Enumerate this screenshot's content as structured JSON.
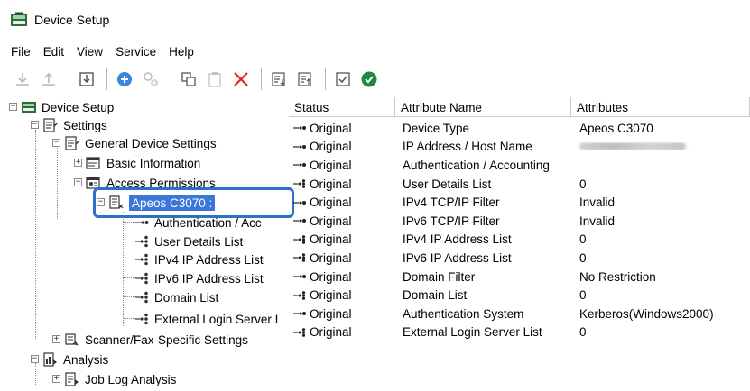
{
  "window": {
    "title": "Device Setup"
  },
  "menu": [
    "File",
    "Edit",
    "View",
    "Service",
    "Help"
  ],
  "tree": {
    "root": "Device Setup",
    "settings": "Settings",
    "general": "General Device Settings",
    "basic": "Basic Information",
    "access": "Access Permissions",
    "device": "Apeos C3070 :",
    "children": [
      "Authentication / Acc",
      "User Details List",
      "IPv4 IP Address List",
      "IPv6 IP Address List",
      "Domain List",
      "External Login Server I"
    ],
    "scanner": "Scanner/Fax-Specific Settings",
    "analysis": "Analysis",
    "joblog": "Job Log Analysis"
  },
  "table": {
    "headers": [
      "Status",
      "Attribute Name",
      "Attributes"
    ],
    "rows": [
      {
        "status": "Original",
        "icon": "single-link-icon",
        "name": "Device Type",
        "value": "Apeos C3070"
      },
      {
        "status": "Original",
        "icon": "single-link-icon",
        "name": "IP Address / Host Name",
        "value": "",
        "blurred": true
      },
      {
        "status": "Original",
        "icon": "single-link-icon",
        "name": "Authentication / Accounting",
        "value": ""
      },
      {
        "status": "Original",
        "icon": "multi-link-icon",
        "name": "User Details List",
        "value": "0"
      },
      {
        "status": "Original",
        "icon": "single-link-icon",
        "name": "IPv4 TCP/IP Filter",
        "value": "Invalid"
      },
      {
        "status": "Original",
        "icon": "single-link-icon",
        "name": "IPv6 TCP/IP Filter",
        "value": "Invalid"
      },
      {
        "status": "Original",
        "icon": "multi-link-icon",
        "name": "IPv4 IP Address List",
        "value": "0"
      },
      {
        "status": "Original",
        "icon": "multi-link-icon",
        "name": "IPv6 IP Address List",
        "value": "0"
      },
      {
        "status": "Original",
        "icon": "single-link-icon",
        "name": "Domain Filter",
        "value": "No Restriction"
      },
      {
        "status": "Original",
        "icon": "multi-link-icon",
        "name": "Domain List",
        "value": "0"
      },
      {
        "status": "Original",
        "icon": "single-link-icon",
        "name": "Authentication System",
        "value": "Kerberos(Windows2000)"
      },
      {
        "status": "Original",
        "icon": "multi-link-icon",
        "name": "External Login Server List",
        "value": "0"
      }
    ]
  },
  "colors": {
    "selection": "#3b77d8",
    "highlight": "#2f6fc6",
    "accent_green": "#1f8a3a",
    "accent_blue": "#3d86d8"
  }
}
